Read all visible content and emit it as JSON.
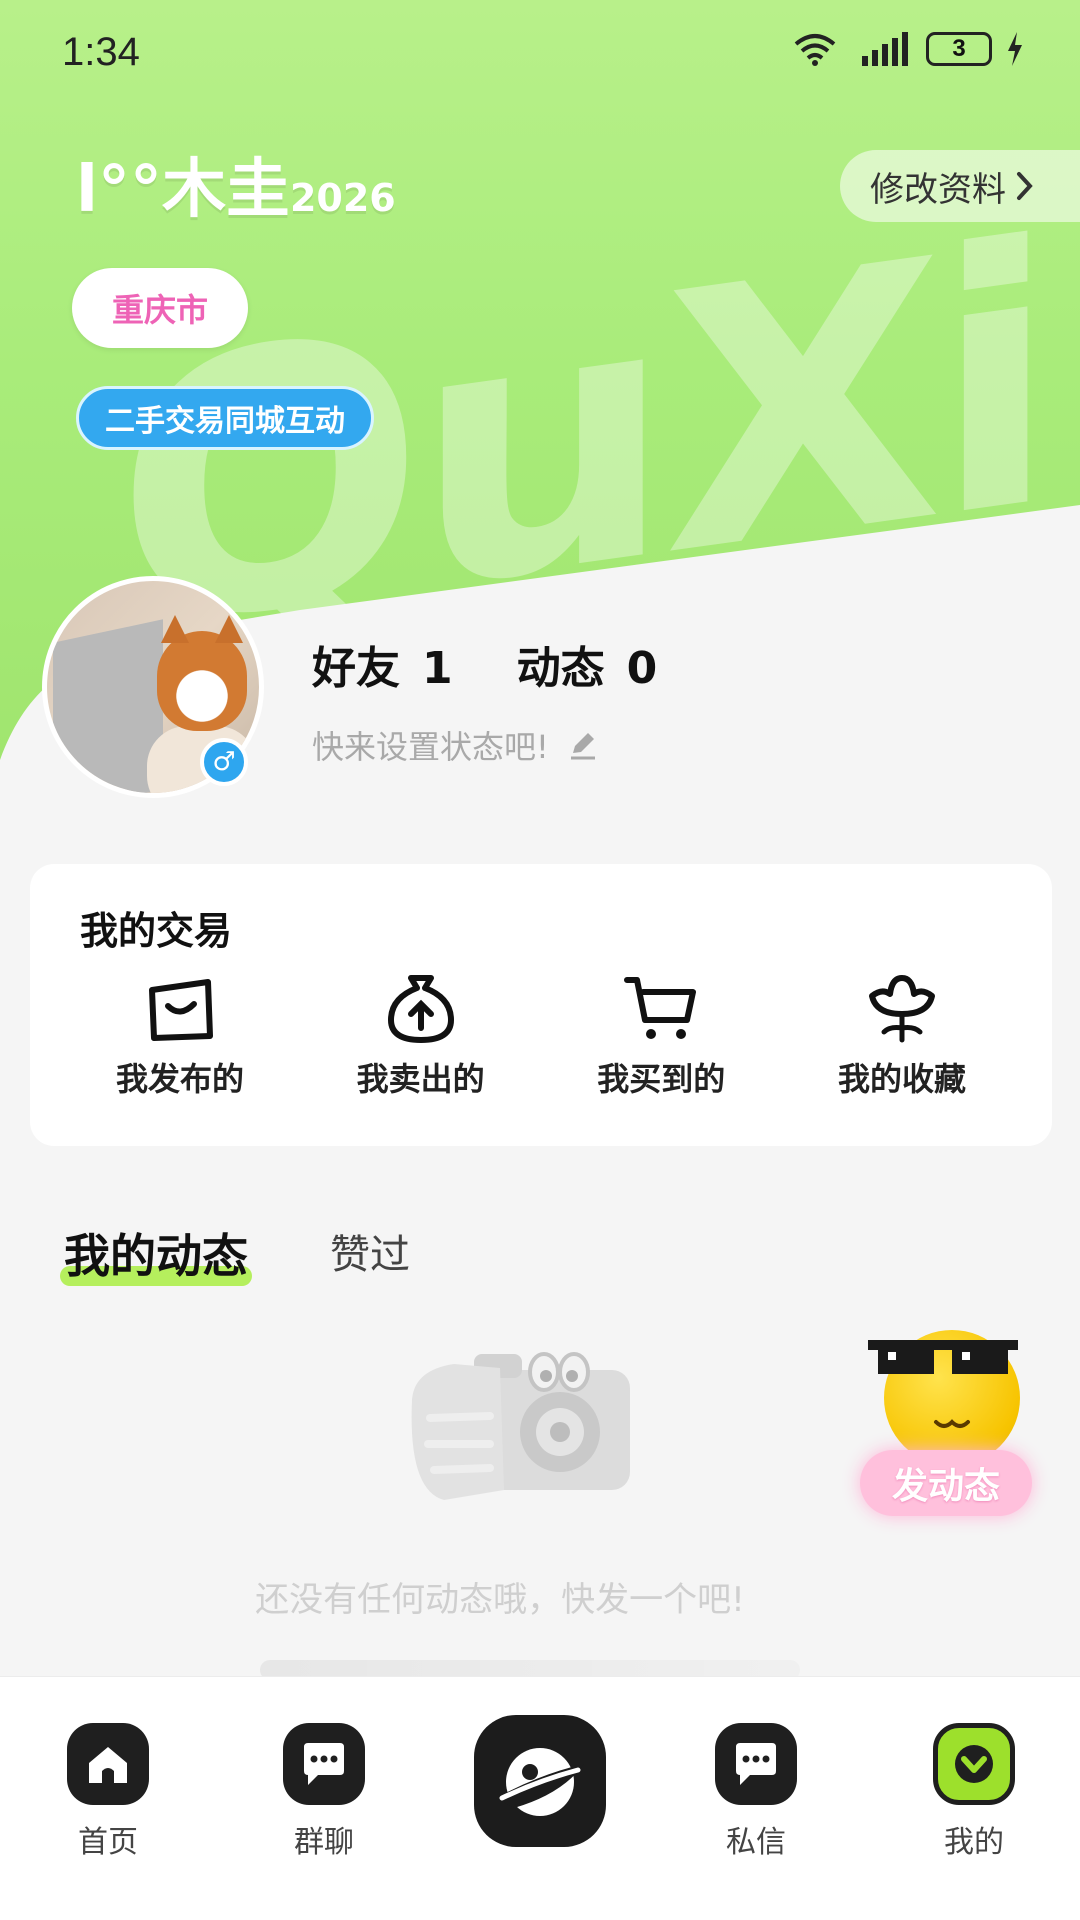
{
  "status_bar": {
    "time": "1:34",
    "battery": "3"
  },
  "header": {
    "brand": "木圭",
    "brand_prefix": "l°°",
    "brand_suffix": "2026",
    "watermark": "QuXi",
    "edit_profile": "修改资料",
    "city": "重庆市",
    "tag": "二手交易同城互动"
  },
  "profile": {
    "friends_label": "好友",
    "friends_count": "1",
    "posts_label": "动态",
    "posts_count": "0",
    "status_placeholder": "快来设置状态吧!",
    "gender_symbol": "♂"
  },
  "trade": {
    "title": "我的交易",
    "items": [
      {
        "label": "我发布的",
        "icon": "shopping-bag-icon"
      },
      {
        "label": "我卖出的",
        "icon": "money-bag-upload-icon"
      },
      {
        "label": "我买到的",
        "icon": "shopping-cart-icon"
      },
      {
        "label": "我的收藏",
        "icon": "flower-icon"
      }
    ]
  },
  "tabs": {
    "active": "我的动态",
    "other": "赞过"
  },
  "empty": {
    "text": "还没有任何动态哦，快发一个吧!"
  },
  "fab": {
    "label": "发动态"
  },
  "bottom_nav": [
    {
      "label": "首页",
      "icon": "home-icon"
    },
    {
      "label": "群聊",
      "icon": "group-chat-icon"
    },
    {
      "label": "",
      "icon": "planet-face-icon"
    },
    {
      "label": "私信",
      "icon": "message-icon"
    },
    {
      "label": "我的",
      "icon": "profile-down-icon"
    }
  ],
  "colors": {
    "accent_green": "#9de02c",
    "tag_blue": "#33a8ef",
    "city_pink": "#ee63b6"
  }
}
